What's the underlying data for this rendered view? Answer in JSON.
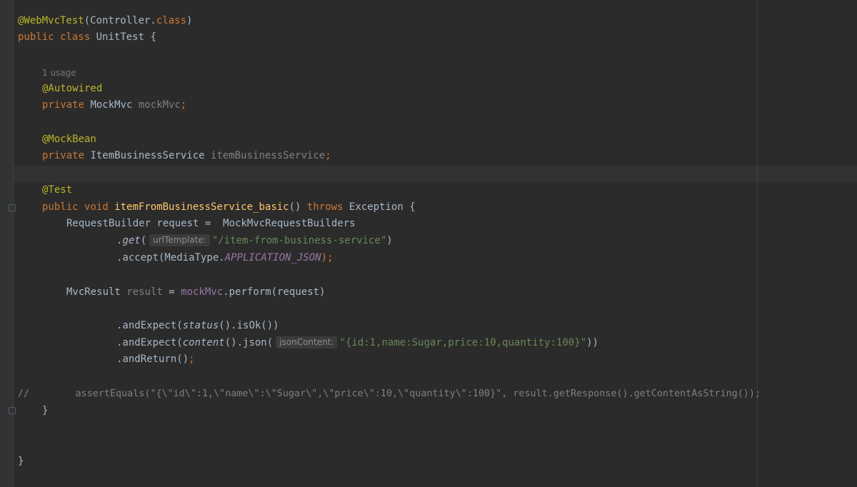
{
  "editor": {
    "lines": [
      {
        "id": "l1",
        "tokens": [
          "@WebMvcTest",
          "(Controller.",
          "class",
          ")"
        ]
      },
      {
        "id": "l2",
        "tokens": [
          "public",
          " ",
          "class",
          " UnitTest {"
        ]
      },
      {
        "id": "l3",
        "tokens": [
          "@Autowired"
        ]
      },
      {
        "id": "l4",
        "tokens": [
          "private",
          " MockMvc ",
          "mockMvc",
          ";"
        ]
      },
      {
        "id": "l5",
        "tokens": [
          "@MockBean"
        ]
      },
      {
        "id": "l6",
        "tokens": [
          "private",
          " ItemBusinessService ",
          "itemBusinessService",
          ";"
        ]
      },
      {
        "id": "l7",
        "tokens": [
          "@Test"
        ]
      },
      {
        "id": "l8",
        "tokens": [
          "public",
          " ",
          "void",
          " ",
          "itemFromBusinessService_basic",
          "() ",
          "throws",
          " Exception {"
        ]
      },
      {
        "id": "l9",
        "tokens": [
          "RequestBuilder request =  MockMvcRequestBuilders"
        ]
      },
      {
        "id": "l10",
        "tokens": [
          ".",
          "get",
          "(",
          "\"/item-from-business-service\"",
          ")"
        ]
      },
      {
        "id": "l11",
        "tokens": [
          ".accept(MediaType.",
          "APPLICATION_JSON",
          ");"
        ]
      },
      {
        "id": "l12",
        "tokens": [
          "MvcResult ",
          "result",
          " = ",
          "mockMvc",
          ".perform(request)"
        ]
      },
      {
        "id": "l13",
        "tokens": [
          ".andExpect(",
          "status",
          "().isOk())"
        ]
      },
      {
        "id": "l14",
        "tokens": [
          ".andExpect(",
          "content",
          "().json(",
          "\"{id:1,name:Sugar,price:10,quantity:100}\"",
          "))"
        ]
      },
      {
        "id": "l15",
        "tokens": [
          ".andReturn()",
          ";"
        ]
      },
      {
        "id": "l16",
        "tokens": [
          "//",
          "        assertEquals(\"{\\\"id\\\":1,\\\"name\\\":\\\"Sugar\\\",\\\"price\\\":10,\\\"quantity\\\":100}\", result.getResponse().getContentAsString());"
        ]
      },
      {
        "id": "l17",
        "tokens": [
          "}"
        ]
      },
      {
        "id": "l18",
        "tokens": [
          "}"
        ]
      }
    ],
    "usage_hint": "1 usage",
    "param_hints": {
      "url_template": "urlTemplate:",
      "json_content": "jsonContent:"
    }
  },
  "colors": {
    "background": "#2b2b2b",
    "annotation": "#bbb529",
    "keyword": "#cc7832",
    "field": "#9876aa",
    "string": "#6a8759",
    "method": "#ffc66d",
    "text": "#a9b7c6"
  }
}
